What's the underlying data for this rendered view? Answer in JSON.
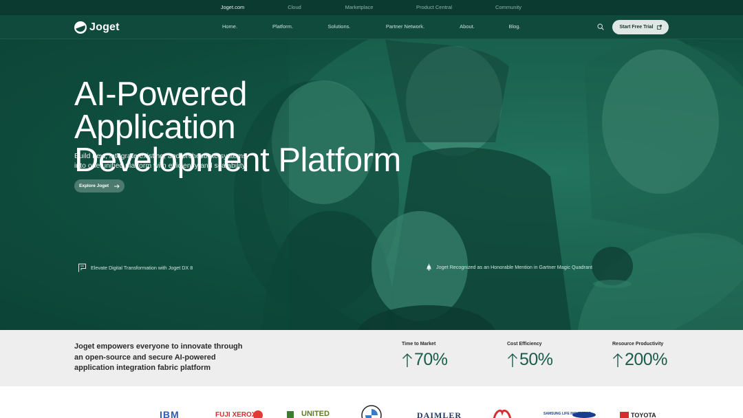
{
  "topbar": {
    "links": [
      "Joget.com",
      "Cloud",
      "Marketplace",
      "Product Central",
      "Community"
    ],
    "active": "Joget.com"
  },
  "nav": {
    "logo_text": "Joget",
    "menu": [
      "Home.",
      "Platform.",
      "Solutions.",
      "Partner Network.",
      "About.",
      "Blog."
    ],
    "cta_label": "Start Free Trial",
    "icons": {
      "search": "search-icon",
      "external": "external-link-icon"
    }
  },
  "hero": {
    "title_line1": "AI-Powered Application",
    "title_line2": "Development Platform",
    "subtitle": "Build new, integrate existing, and orchestrate systems into one unified platform with efficiency and scalability.",
    "button_label": "Explore Joget",
    "announcement_left": "Elevate Digital Transformation with Joget DX 8",
    "announcement_right": "Joget Recognized as an Honorable Mention in Gartner Magic Quadrant"
  },
  "stats": {
    "tagline": "Joget empowers everyone to innovate through an open-source and secure AI-powered application integration fabric platform",
    "items": [
      {
        "label": "Time to Market",
        "value": "70%"
      },
      {
        "label": "Cost Efficiency",
        "value": "50%"
      },
      {
        "label": "Resource Productivity",
        "value": "200%"
      }
    ]
  },
  "logos": [
    "IBM",
    "FUJI XEROX",
    "UNITED",
    "BMW",
    "DAIMLER",
    "Jardines",
    "SAMSUNG LIFE INSURANCE",
    "TOYOTA"
  ],
  "colors": {
    "brand_dark": "#0f4a3d",
    "topbar": "#0a3a30",
    "stat_accent": "#1b5c4b"
  }
}
